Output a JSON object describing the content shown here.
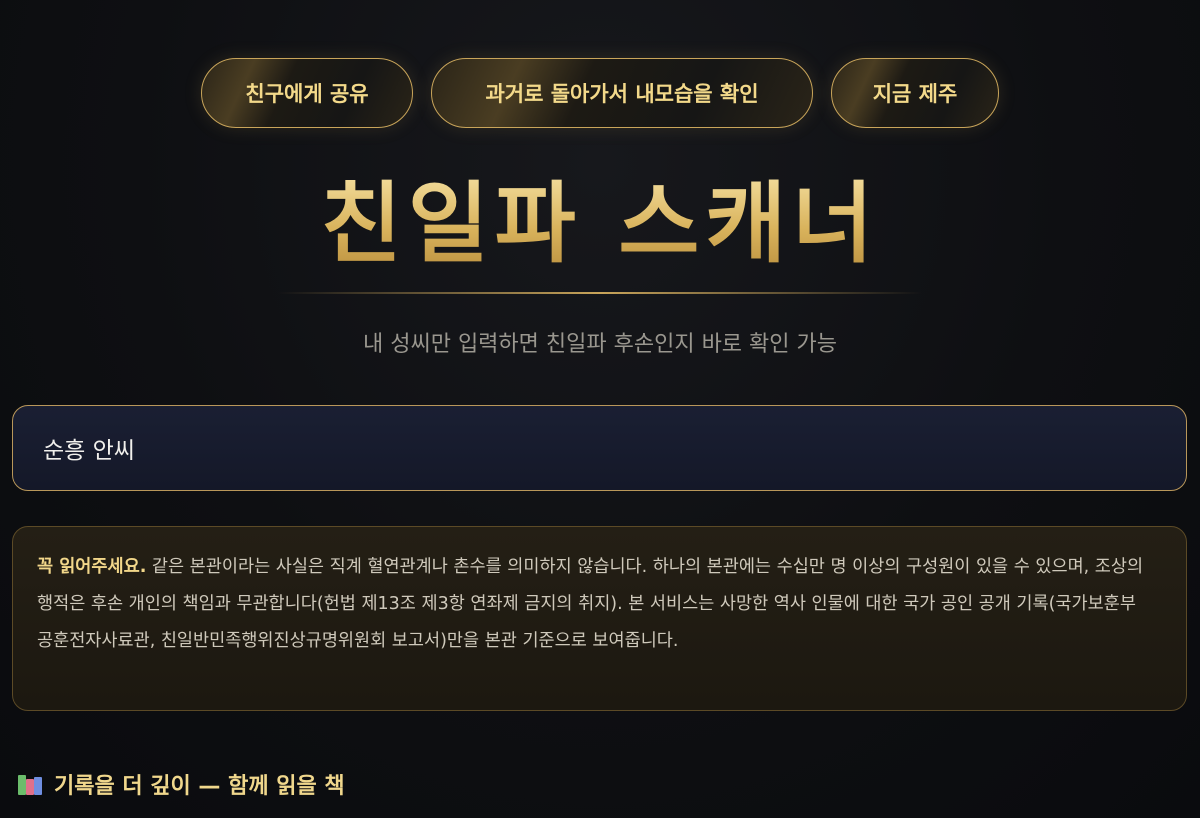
{
  "nav": {
    "share_label": "친구에게 공유",
    "past_label": "과거로 돌아가서 내모습을 확인",
    "jeju_label": "지금 제주"
  },
  "header": {
    "title": "친일파 스캐너",
    "subtitle": "내 성씨만 입력하면 친일파 후손인지 바로 확인 가능"
  },
  "search": {
    "value": "순흥 안씨"
  },
  "notice": {
    "lead": "꼭 읽어주세요.",
    "body": " 같은 본관이라는 사실은 직계 혈연관계나 촌수를 의미하지 않습니다. 하나의 본관에는 수십만 명 이상의 구성원이 있을 수 있으며, 조상의 행적은 후손 개인의 책임과 무관합니다(헌법 제13조 제3항 연좌제 금지의 취지). 본 서비스는 사망한 역사 인물에 대한 국가 공인 공개 기록(국가보훈부 공훈전자사료관, 친일반민족행위진상규명위원회 보고서)만을 본관 기준으로 보여줍니다."
  },
  "books": {
    "heading": "기록을 더 깊이 — 함께 읽을 책",
    "icon": "books-icon"
  },
  "colors": {
    "gold": "#c9a55a",
    "title_gold": "#e6c36c",
    "background": "#0e0f12"
  }
}
